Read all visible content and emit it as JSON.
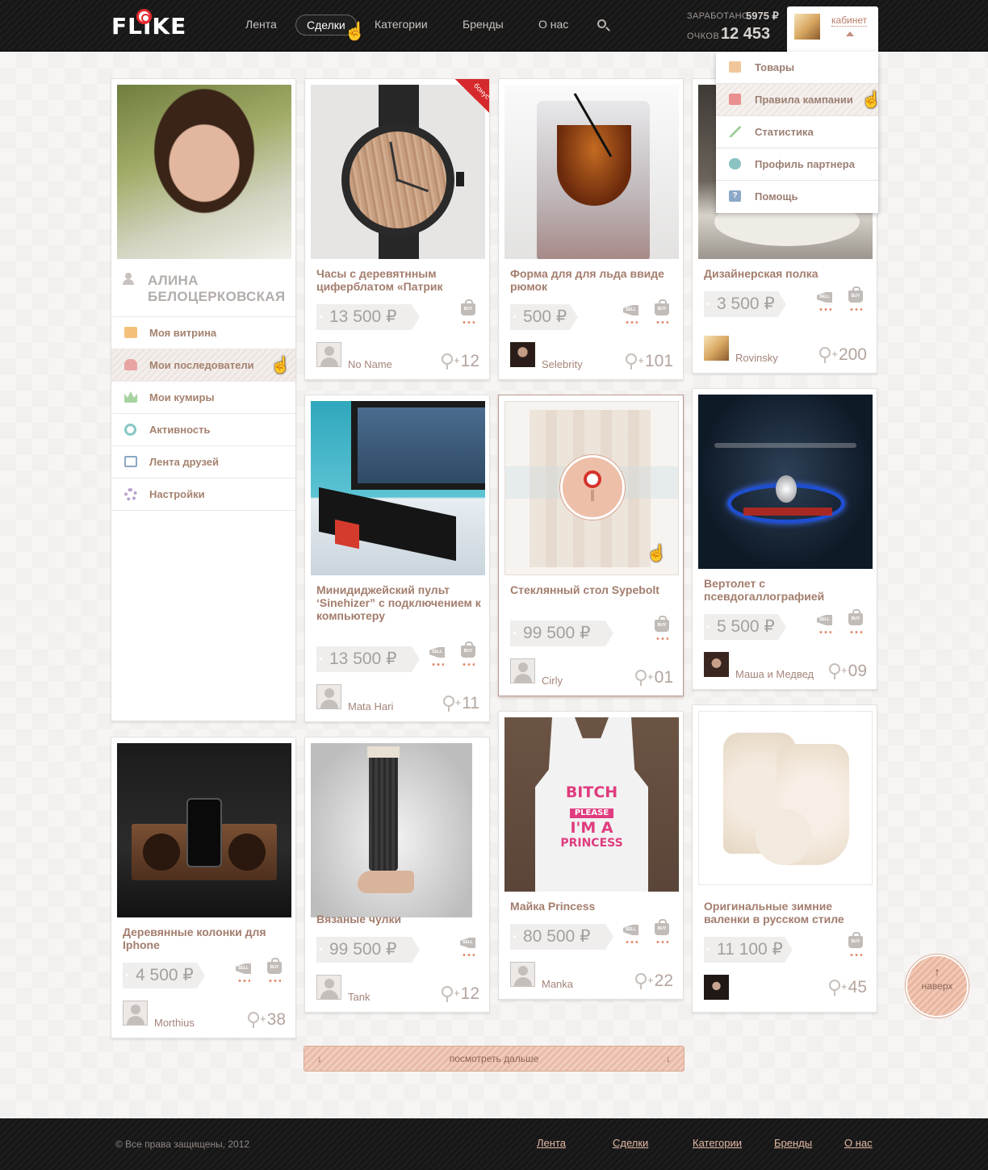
{
  "header": {
    "logo": "FLIKE",
    "nav": [
      "Лента",
      "Сделки",
      "Категории",
      "Бренды",
      "О нас"
    ],
    "earned_label": "ЗАРАБОТАНО",
    "earned_value": "5975 ₽",
    "points_label": "ОЧКОВ",
    "points_value": "12 453",
    "cabinet": "кабинет"
  },
  "dropdown": [
    "Товары",
    "Правила кампании",
    "Статистика",
    "Профиль партнера",
    "Помощь"
  ],
  "profile": {
    "name_line1": "АЛИНА",
    "name_line2": "БЕЛОЦЕРКОВСКАЯ",
    "menu": [
      "Моя витрина",
      "Мои последователи",
      "Мои кумиры",
      "Активность",
      "Лента друзей",
      "Настройки"
    ]
  },
  "products": [
    {
      "title": "Часы с деревятнным циферблатом «Патрик",
      "price": "13 500 ₽",
      "user": "No Name",
      "likes": "12",
      "badge": "бонус"
    },
    {
      "title": "Форма для для льда ввиде рюмок",
      "price": "500 ₽",
      "user": "Selebrity",
      "likes": "101"
    },
    {
      "title": "Дизайнерская полка",
      "price": "3 500 ₽",
      "user": "Rovinsky",
      "likes": "200"
    },
    {
      "title": "Минидиджейский пульт ‘Sinehizer” с подключением к компьютеру",
      "price": "13 500 ₽",
      "user": "Mata Hari",
      "likes": "11"
    },
    {
      "title": "Стеклянный стол Sypebolt",
      "price": "99 500 ₽",
      "user": "Cirly",
      "likes": "01"
    },
    {
      "title": "Вертолет с псевдогаллографией",
      "price": "5 500 ₽",
      "user": "Маша и Медвед",
      "likes": "09"
    },
    {
      "title": "Деревянные колонки для Iphone",
      "price": "4 500 ₽",
      "user": "Morthius",
      "likes": "38"
    },
    {
      "title": "Вязаные чулки",
      "price": "99 500 ₽",
      "user": "Tank",
      "likes": "12"
    },
    {
      "title": "Майка Princess",
      "price": "80 500 ₽",
      "user": "Manka",
      "likes": "22",
      "shirt": {
        "l1": "BITCH",
        "l2": "PLEASE",
        "l3": "I'M A",
        "l4": "PRINCESS"
      }
    },
    {
      "title": "Оригинальные зимние валенки в русском стиле",
      "price": "11 100 ₽",
      "user": "",
      "likes": "45"
    }
  ],
  "actions": {
    "sell": "SELL",
    "buy": "BUY",
    "plus": "+"
  },
  "more_label": "посмотреть дальше",
  "top_label": "наверх",
  "footer": {
    "copyright": "© Все права защищены, 2012",
    "links": [
      "Лента",
      "Сделки",
      "Категории",
      "Бренды",
      "О нас"
    ]
  },
  "colors": {
    "accent": "#a37d6d",
    "bonus": "#d6292b",
    "header_bg": "#1a1a1a"
  }
}
